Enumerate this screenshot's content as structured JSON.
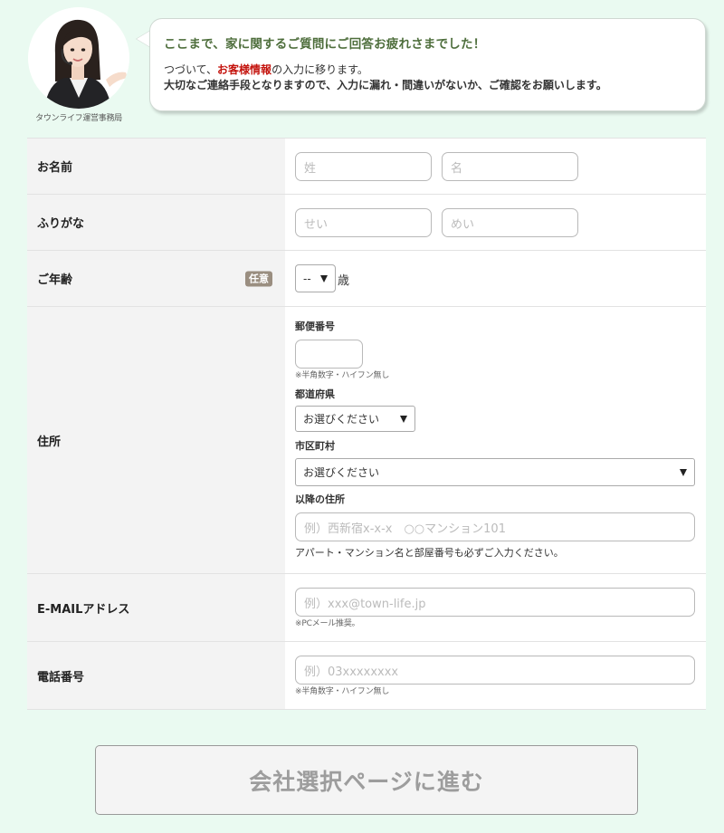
{
  "header": {
    "operator_caption": "タウンライフ運営事務局",
    "avatar_icon": "operator-photo",
    "heading": "ここまで、家に関するご質問にご回答お疲れさまでした！",
    "line1_prefix": "つづいて、",
    "line1_highlight": "お客様情報",
    "line1_suffix": "の入力に移ります。",
    "line2": "大切なご連絡手段となりますので、入力に漏れ・間違いがないか、ご確認をお願いします。",
    "highlight_color": "#c4140e"
  },
  "form": {
    "name": {
      "label": "お名前",
      "last_placeholder": "姓",
      "first_placeholder": "名"
    },
    "furigana": {
      "label": "ふりがな",
      "last_placeholder": "せい",
      "first_placeholder": "めい"
    },
    "age": {
      "label": "ご年齢",
      "badge": "任意",
      "selected": "--",
      "unit": "歳"
    },
    "address": {
      "label": "住所",
      "postal_label": "郵便番号",
      "postal_note": "※半角数字・ハイフン無し",
      "prefecture_label": "都道府県",
      "prefecture_selected": "お選びください",
      "city_label": "市区町村",
      "city_selected": "お選びください",
      "street_label": "以降の住所",
      "street_placeholder": "例）西新宿x-x-x　○○マンション101",
      "street_hint": "アパート・マンション名と部屋番号も必ずご入力ください。"
    },
    "email": {
      "label": "E-MAILアドレス",
      "placeholder": "例）xxx@town-life.jp",
      "note": "※PCメール推奨。"
    },
    "phone": {
      "label": "電話番号",
      "placeholder": "例）03xxxxxxxx",
      "note": "※半角数字・ハイフン無し"
    }
  },
  "submit": {
    "label": "会社選択ページに進む"
  },
  "colors": {
    "background": "#eafaf1",
    "heading": "#4e6e3c",
    "badge": "#9a8e80"
  }
}
